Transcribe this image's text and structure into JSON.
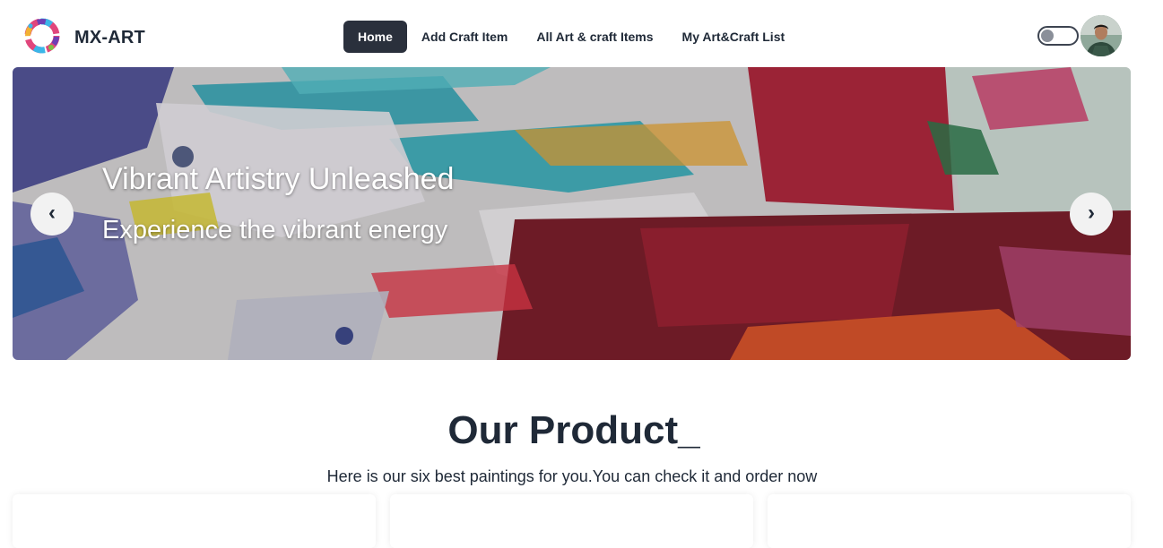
{
  "brand": {
    "name": "MX-ART",
    "logo_icon": "color-splash-logo-icon"
  },
  "nav": {
    "items": [
      {
        "label": "Home",
        "active": true
      },
      {
        "label": "Add Craft Item",
        "active": false
      },
      {
        "label": "All Art & craft Items",
        "active": false
      },
      {
        "label": "My Art&Craft List",
        "active": false
      }
    ],
    "theme_toggle": {
      "state": "off"
    },
    "avatar_icon": "user-avatar-icon"
  },
  "hero": {
    "title": "Vibrant Artistry Unleashed",
    "subtitle": "Experience the vibrant energy",
    "prev_label": "‹",
    "next_label": "›"
  },
  "products": {
    "title": "Our Product_",
    "subtitle": "Here is our six best paintings for you.You can check it and order now",
    "card_count": 3
  },
  "colors": {
    "accent_dark": "#2a303c",
    "text": "#1f2937"
  }
}
